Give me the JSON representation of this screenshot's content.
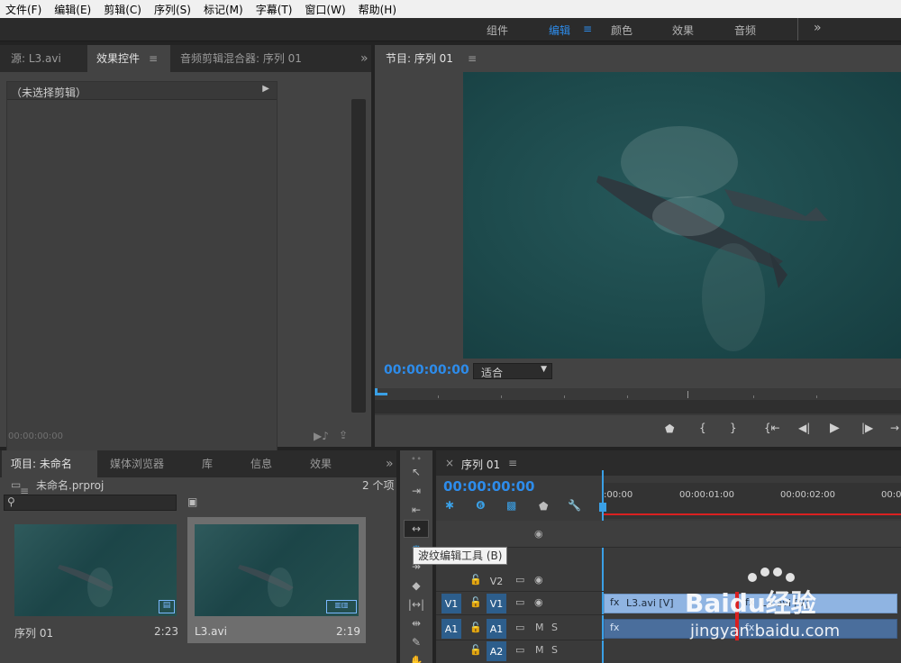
{
  "menu": [
    "文件(F)",
    "编辑(E)",
    "剪辑(C)",
    "序列(S)",
    "标记(M)",
    "字幕(T)",
    "窗口(W)",
    "帮助(H)"
  ],
  "workspaces": {
    "items": [
      "组件",
      "编辑",
      "颜色",
      "效果",
      "音频"
    ],
    "active": "编辑",
    "more": "»"
  },
  "source_panel": {
    "tabs": [
      "源: L3.avi",
      "效果控件",
      "音频剪辑混合器: 序列 01"
    ],
    "active": "效果控件",
    "more": "»",
    "no_clip": "（未选择剪辑）",
    "timecode": "00:00:00:00"
  },
  "program_monitor": {
    "title": "节目: 序列 01",
    "timecode": "00:00:00:00",
    "fit": "适合"
  },
  "project_panel": {
    "tabs": [
      "项目: 未命名",
      "媒体浏览器",
      "库",
      "信息",
      "效果"
    ],
    "more": "»",
    "project_file": "未命名.prproj",
    "item_count": "2 个项",
    "items": [
      {
        "name": "序列 01",
        "duration": "2:23"
      },
      {
        "name": "L3.avi",
        "duration": "2:19"
      }
    ]
  },
  "timeline": {
    "tab": "序列 01",
    "timecode": "00:00:00:00",
    "ruler": [
      ":00:00",
      "00:00:01:00",
      "00:00:02:00",
      "00:0"
    ],
    "tracks": [
      {
        "src": "",
        "label": "V2",
        "m": "",
        "s": ""
      },
      {
        "src": "V1",
        "label": "V1",
        "m": "",
        "s": ""
      },
      {
        "src": "A1",
        "label": "A1",
        "m": "M",
        "s": "S"
      },
      {
        "src": "",
        "label": "A2",
        "m": "M",
        "s": "S"
      }
    ],
    "video_clip": "L3.avi [V]",
    "video_clip2": "L3.avi [V]"
  },
  "tooltip": "波纹编辑工具 (B)",
  "watermark": {
    "brand": "Baidu经验",
    "url": "jingyan.baidu.com"
  },
  "colors": {
    "accent": "#2d8ceb",
    "clip_video": "#8fb4e2",
    "clip_audio": "#4a6e9c",
    "playhead": "#3aa0e6",
    "red": "#d92020"
  }
}
